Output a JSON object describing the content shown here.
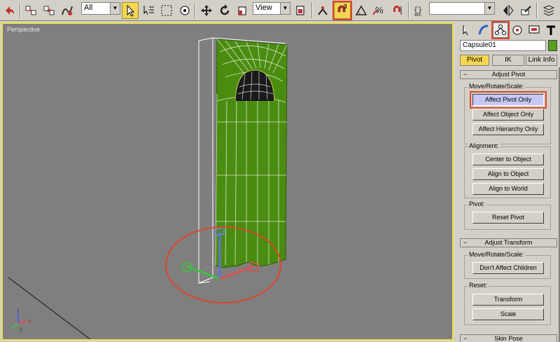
{
  "toolbar": {
    "selection_filter": "All",
    "coord_system": "View",
    "named_selection": "",
    "icons": [
      "undo-icon",
      "redo-icon",
      "link-icon",
      "unlink-icon",
      "bind-space-warp-icon",
      "select-object-icon",
      "select-by-name-icon",
      "rectangle-selection-icon",
      "window-crossing-icon",
      "move-icon",
      "rotate-icon",
      "scale-icon",
      "pivot-center-icon",
      "manipulate-icon",
      "3d-snap-icon",
      "angle-snap-icon",
      "percent-snap-icon",
      "spinner-snap-icon",
      "edit-named-selections-icon",
      "mirror-icon",
      "align-icon",
      "layers-icon"
    ],
    "snap_label": "3"
  },
  "viewport": {
    "label": "Perspective",
    "background": "#7f7f7f",
    "border": "#f1e24a",
    "object_color": "#4a8c10",
    "axis_labels": {
      "x": "x",
      "y": "y",
      "z": "z"
    }
  },
  "command_panel": {
    "object_name": "Capsule01",
    "object_color": "#56a01e",
    "subtabs": [
      "Pivot",
      "IK",
      "Link Info"
    ],
    "adjust_pivot": {
      "title": "Adjust Pivot",
      "move_group": "Move/Rotate/Scale:",
      "affect_pivot_only": "Affect Pivot Only",
      "affect_object_only": "Affect Object Only",
      "affect_hierarchy_only": "Affect Hierarchy Only",
      "alignment_group": "Alignment:",
      "center_to_object": "Center to Object",
      "align_to_object": "Align to Object",
      "align_to_world": "Align to World",
      "pivot_group": "Pivot:",
      "reset_pivot": "Reset Pivot"
    },
    "adjust_transform": {
      "title": "Adjust Transform",
      "move_group": "Move/Rotate/Scale:",
      "dont_affect_children": "Don't Affect Children",
      "reset_group": "Reset:",
      "transform": "Transform",
      "scale": "Scale"
    },
    "skin_pose": {
      "title": "Skin Pose"
    }
  }
}
